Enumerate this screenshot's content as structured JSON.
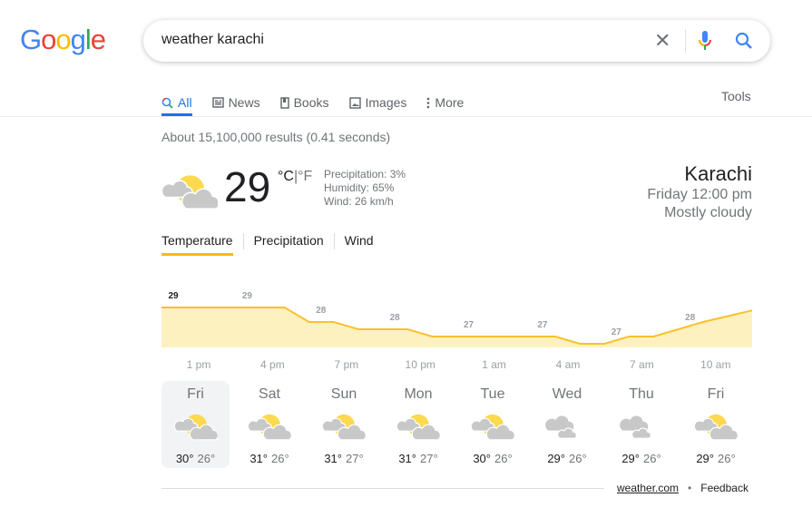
{
  "logo": "Google",
  "search": {
    "query": "weather karachi",
    "clear_icon": "close-icon",
    "mic_icon": "mic-icon",
    "search_icon": "search-icon"
  },
  "tabs": [
    {
      "label": "All",
      "icon": "search-icon",
      "active": true
    },
    {
      "label": "News",
      "icon": "newspaper-icon"
    },
    {
      "label": "Books",
      "icon": "book-icon"
    },
    {
      "label": "Images",
      "icon": "image-icon"
    },
    {
      "label": "More",
      "icon": "more-vert-icon"
    }
  ],
  "tools_label": "Tools",
  "result_stats": "About 15,100,000 results (0.41 seconds)",
  "current": {
    "temperature": "29",
    "unit_c": "°C",
    "unit_sep": "|",
    "unit_f": "°F",
    "precipitation": "Precipitation: 3%",
    "humidity": "Humidity: 65%",
    "wind": "Wind: 26 km/h",
    "icon": "partly-cloudy-icon"
  },
  "location": {
    "city": "Karachi",
    "time": "Friday 12:00 pm",
    "condition": "Mostly cloudy"
  },
  "weather_tabs": [
    {
      "label": "Temperature",
      "active": true
    },
    {
      "label": "Precipitation"
    },
    {
      "label": "Wind"
    }
  ],
  "chart_data": {
    "type": "area",
    "hourly_temperatures": [
      29,
      29,
      29,
      29,
      29,
      29,
      28,
      28,
      27.5,
      27.5,
      27.5,
      27,
      27,
      27,
      27,
      27,
      27,
      26.5,
      26.5,
      27,
      27,
      27.5,
      28,
      28.4,
      28.8
    ],
    "point_labels": [
      "29",
      "29",
      "28",
      "28",
      "27",
      "27",
      "27",
      "28"
    ],
    "time_labels": [
      "1 pm",
      "4 pm",
      "7 pm",
      "10 pm",
      "1 am",
      "4 am",
      "7 am",
      "10 am"
    ],
    "ylim": [
      26.25,
      29.5
    ],
    "line_color": "#fbc02d",
    "fill_color": "#fef1c0"
  },
  "forecast": [
    {
      "day": "Fri",
      "icon": "partly-cloudy",
      "high": "30°",
      "low": "26°",
      "selected": true
    },
    {
      "day": "Sat",
      "icon": "partly-cloudy",
      "high": "31°",
      "low": "26°"
    },
    {
      "day": "Sun",
      "icon": "partly-cloudy",
      "high": "31°",
      "low": "27°"
    },
    {
      "day": "Mon",
      "icon": "partly-cloudy",
      "high": "31°",
      "low": "27°"
    },
    {
      "day": "Tue",
      "icon": "partly-cloudy",
      "high": "30°",
      "low": "26°"
    },
    {
      "day": "Wed",
      "icon": "cloudy",
      "high": "29°",
      "low": "26°"
    },
    {
      "day": "Thu",
      "icon": "cloudy",
      "high": "29°",
      "low": "26°"
    },
    {
      "day": "Fri",
      "icon": "partly-cloudy",
      "high": "29°",
      "low": "26°"
    }
  ],
  "footer": {
    "source": "weather.com",
    "bullet": "•",
    "feedback": "Feedback"
  }
}
